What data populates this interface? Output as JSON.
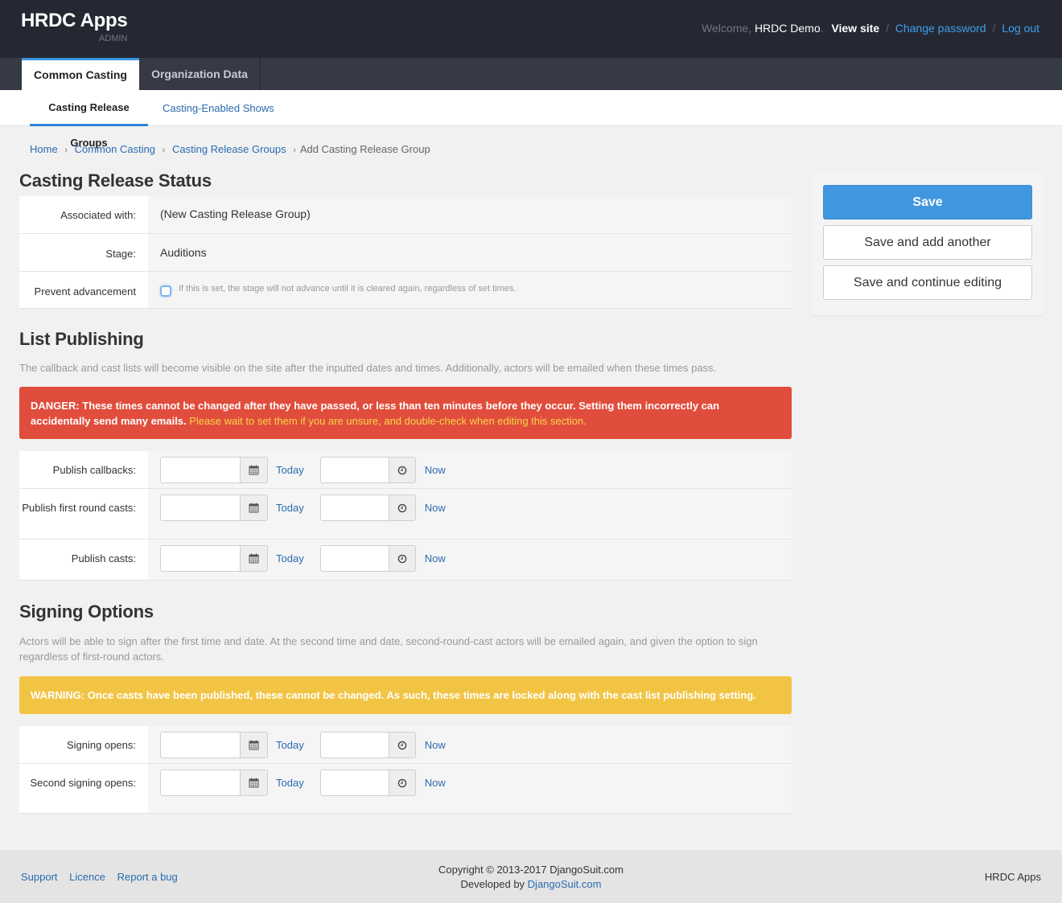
{
  "header": {
    "brand_title": "HRDC Apps",
    "brand_sub": "ADMIN",
    "welcome": "Welcome,",
    "username": "HRDC Demo",
    "view_site": "View site",
    "change_password": "Change password",
    "log_out": "Log out",
    "separator": "/"
  },
  "primary_nav": {
    "tabs": [
      {
        "label": "Common Casting",
        "active": true
      },
      {
        "label": "Organization Data",
        "active": false
      }
    ]
  },
  "secondary_nav": {
    "tabs": [
      {
        "label": "Casting Release Groups",
        "active": true
      },
      {
        "label": "Casting-Enabled Shows",
        "active": false
      }
    ]
  },
  "breadcrumb": {
    "items": [
      "Home",
      "Common Casting",
      "Casting Release Groups"
    ],
    "current": "Add Casting Release Group",
    "separator": "›"
  },
  "sections": {
    "status": {
      "title": "Casting Release Status",
      "associated_label": "Associated with:",
      "associated_value": "(New Casting Release Group)",
      "stage_label": "Stage:",
      "stage_value": "Auditions",
      "prevent_label": "Prevent advancement",
      "prevent_checked": false,
      "prevent_help": "If this is set, the stage will not advance until it is cleared again, regardless of set times."
    },
    "publishing": {
      "title": "List Publishing",
      "description": "The callback and cast lists will become visible on the site after the inputted dates and times. Additionally, actors will be emailed when these times pass.",
      "danger_text": "DANGER: These times cannot be changed after they have passed, or less than ten minutes before they occur. Setting them incorrectly can accidentally send many emails.",
      "danger_emph": "Please wait to set them if you are unsure, and double-check when editing this section.",
      "rows": [
        {
          "label": "Publish callbacks:",
          "date": "",
          "time": ""
        },
        {
          "label": "Publish first round casts:",
          "date": "",
          "time": ""
        },
        {
          "label": "Publish casts:",
          "date": "",
          "time": ""
        }
      ]
    },
    "signing": {
      "title": "Signing Options",
      "description": "Actors will be able to sign after the first time and date. At the second time and date, second-round-cast actors will be emailed again, and given the option to sign regardless of first-round actors.",
      "warning_text": "WARNING: Once casts have been published, these cannot be changed. As such, these times are locked along with the cast list publishing setting.",
      "rows": [
        {
          "label": "Signing opens:",
          "date": "",
          "time": ""
        },
        {
          "label": "Second signing opens:",
          "date": "",
          "time": ""
        }
      ]
    }
  },
  "shortcuts": {
    "today": "Today",
    "now": "Now"
  },
  "submit": {
    "save": "Save",
    "save_add_another": "Save and add another",
    "save_continue": "Save and continue editing"
  },
  "footer": {
    "links": [
      "Support",
      "Licence",
      "Report a bug"
    ],
    "copyright": "Copyright © 2013-2017 DjangoSuit.com",
    "developed_by": "Developed by",
    "developer_link": "DjangoSuit.com",
    "right_text": "HRDC Apps"
  },
  "colors": {
    "header_bg": "#252833",
    "nav_bg": "#363a47",
    "accent": "#4197df",
    "link": "#2a6bb0",
    "danger": "#e14d3c",
    "warning": "#f2c443"
  }
}
